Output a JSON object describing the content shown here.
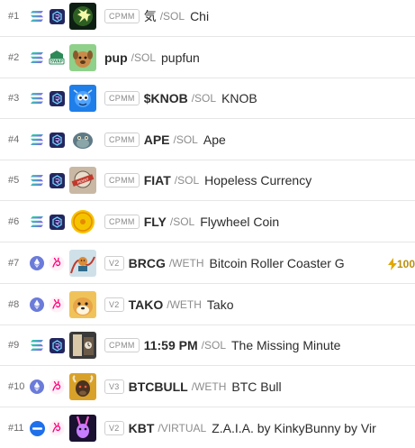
{
  "rows": [
    {
      "rank": "#1",
      "chain": "sol",
      "dex": "raydium",
      "tag": "CPMM",
      "symbol": "気",
      "pair": "/SOL",
      "name": "Chi",
      "avatar": "chi"
    },
    {
      "rank": "#2",
      "chain": "sol",
      "dex": "swap",
      "tag": "",
      "symbol": "pup",
      "pair": "/SOL",
      "name": "pupfun",
      "avatar": "pup"
    },
    {
      "rank": "#3",
      "chain": "sol",
      "dex": "raydium",
      "tag": "CPMM",
      "symbol": "$KNOB",
      "pair": "/SOL",
      "name": "KNOB",
      "avatar": "knob"
    },
    {
      "rank": "#4",
      "chain": "sol",
      "dex": "raydium",
      "tag": "CPMM",
      "symbol": "APE",
      "pair": "/SOL",
      "name": "Ape",
      "avatar": "ape"
    },
    {
      "rank": "#5",
      "chain": "sol",
      "dex": "raydium",
      "tag": "CPMM",
      "symbol": "FIAT",
      "pair": "/SOL",
      "name": "Hopeless Currency",
      "avatar": "fiat"
    },
    {
      "rank": "#6",
      "chain": "sol",
      "dex": "raydium",
      "tag": "CPMM",
      "symbol": "FLY",
      "pair": "/SOL",
      "name": "Flywheel Coin",
      "avatar": "fly"
    },
    {
      "rank": "#7",
      "chain": "eth",
      "dex": "uniswap",
      "tag": "V2",
      "symbol": "BRCG",
      "pair": "/WETH",
      "name": "Bitcoin Roller Coaster G",
      "avatar": "brcg",
      "boost": "100"
    },
    {
      "rank": "#8",
      "chain": "eth",
      "dex": "uniswap",
      "tag": "V2",
      "symbol": "TAKO",
      "pair": "/WETH",
      "name": "Tako",
      "avatar": "tako"
    },
    {
      "rank": "#9",
      "chain": "sol",
      "dex": "raydium",
      "tag": "CPMM",
      "symbol": "11:59 PM",
      "pair": "/SOL",
      "name": "The Missing Minute",
      "avatar": "minute"
    },
    {
      "rank": "#10",
      "chain": "eth",
      "dex": "uniswap",
      "tag": "V3",
      "symbol": "BTCBULL",
      "pair": "/WETH",
      "name": "BTC Bull",
      "avatar": "bull"
    },
    {
      "rank": "#11",
      "chain": "virtual",
      "dex": "uniswap",
      "tag": "V2",
      "symbol": "KBT",
      "pair": "/VIRTUAL",
      "name": "Z.A.I.A. by KinkyBunny by Vir",
      "avatar": "kbt"
    }
  ],
  "colors": {
    "solana_a": "#9945ff",
    "solana_b": "#14f195",
    "raydium": "#2b2f6e",
    "uniswap": "#ff007a",
    "ethereum": "#627eea",
    "virtual": "#1f6feb",
    "boost": "#b8900e"
  }
}
